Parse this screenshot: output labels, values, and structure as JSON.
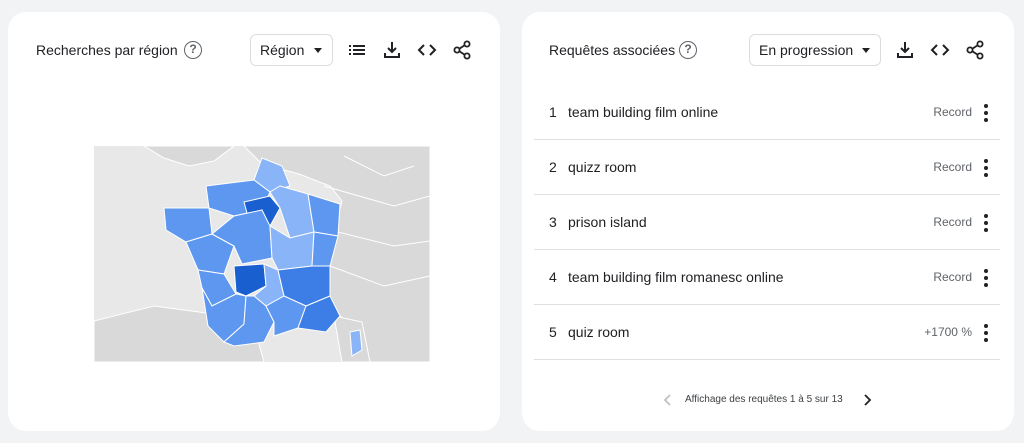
{
  "left_panel": {
    "title": "Recherches par région",
    "help_icon": "help-circle-icon",
    "select": {
      "selected": "Région"
    },
    "tools": [
      "list-icon",
      "download-icon",
      "code-embed-icon",
      "share-icon"
    ],
    "map": {
      "region": "France",
      "legend": "none",
      "colors": {
        "background": "#e8e8e8",
        "land_other": "#d9d9d9",
        "low": "#8ab4f8",
        "mid": "#5e97f0",
        "high": "#3c7ee6",
        "top": "#1a5fd0"
      },
      "darkest_regions": [
        "Île-de-France",
        "Limousin"
      ]
    }
  },
  "right_panel": {
    "title": "Requêtes associées",
    "help_icon": "help-circle-icon",
    "select": {
      "selected": "En progression"
    },
    "tools": [
      "download-icon",
      "code-embed-icon",
      "share-icon"
    ],
    "rows": [
      {
        "rank": "1",
        "query": "team building film online",
        "value": "Record"
      },
      {
        "rank": "2",
        "query": "quizz room",
        "value": "Record"
      },
      {
        "rank": "3",
        "query": "prison island",
        "value": "Record"
      },
      {
        "rank": "4",
        "query": "team building film romanesc online",
        "value": "Record"
      },
      {
        "rank": "5",
        "query": "quiz room",
        "value": "+1700 %"
      }
    ],
    "pagination": {
      "text": "Affichage des requêtes 1 à 5 sur 13"
    }
  }
}
